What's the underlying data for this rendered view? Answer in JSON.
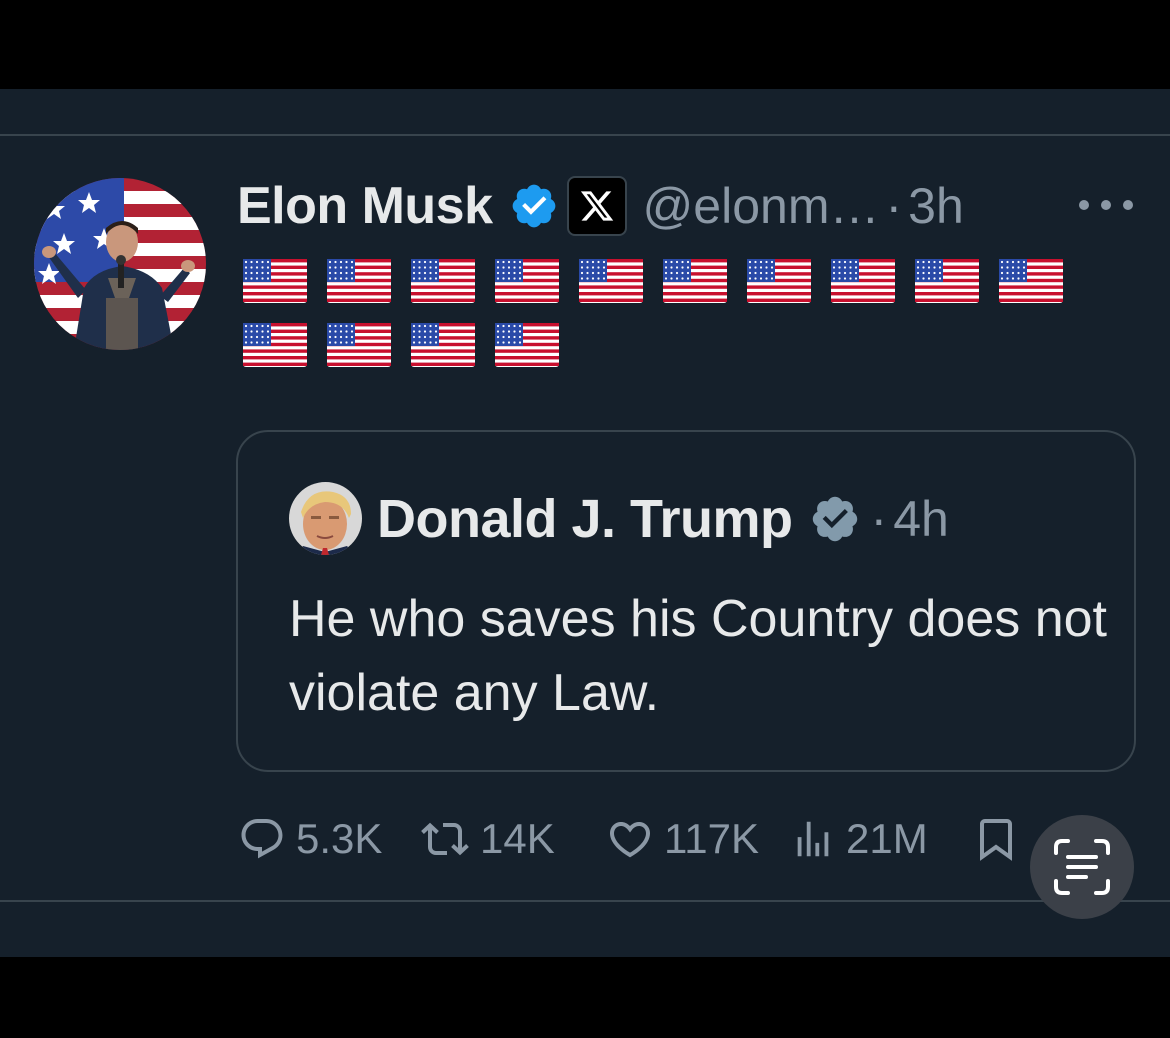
{
  "tweet": {
    "author_name": "Elon Musk",
    "handle": "@elonm…",
    "separator": "·",
    "time": "3h",
    "flag_count": 14,
    "avatar_icon": "avatar-photo"
  },
  "quoted": {
    "author_name": "Donald J. Trump",
    "separator": "·",
    "time": "4h",
    "text": "He who saves his Country does not violate any Law."
  },
  "actions": {
    "replies": "5.3K",
    "reposts": "14K",
    "likes": "117K",
    "views": "21M"
  },
  "colors": {
    "background": "#15202b",
    "border": "#38444d",
    "text": "#e7e9ea",
    "secondary": "#8b98a5",
    "verified_blue": "#1d9bf0",
    "verified_gray": "#829aab"
  },
  "icons": [
    "verified-badge-icon",
    "x-affiliation-icon",
    "more-icon",
    "reply-icon",
    "repost-icon",
    "like-icon",
    "views-icon",
    "bookmark-icon",
    "text-scan-icon",
    "us-flag-icon"
  ]
}
